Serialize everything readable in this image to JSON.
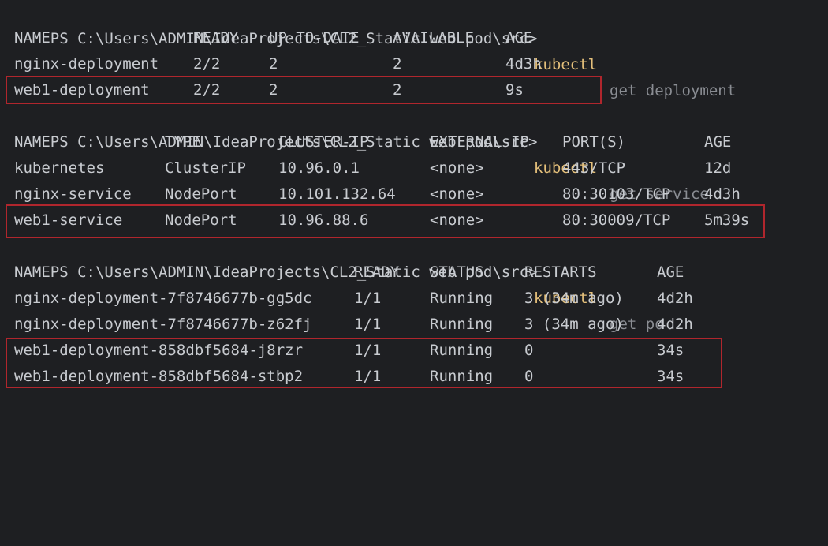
{
  "terminal": {
    "prompt": "PS C:\\Users\\ADMIN\\IdeaProjects\\CL2_Static web pod\\src>",
    "colors": {
      "background": "#1e1f22",
      "text": "#c8cbd0",
      "command": "#e5c07b",
      "args": "#8a8d93",
      "highlight_border": "#b0262d"
    },
    "deployment": {
      "command": "kubectl",
      "args": "get deployment",
      "headers": [
        "NAME",
        "READY",
        "UP-TO-DATE",
        "AVAILABLE",
        "AGE"
      ],
      "rows": [
        [
          "nginx-deployment",
          "2/2",
          "2",
          "2",
          "4d3h"
        ],
        [
          "web1-deployment",
          "2/2",
          "2",
          "2",
          "9s"
        ]
      ]
    },
    "service": {
      "command": "kubectl",
      "args": "get service",
      "headers": [
        "NAME",
        "TYPE",
        "CLUSTER-IP",
        "EXTERNAL-IP",
        "PORT(S)",
        "AGE"
      ],
      "rows": [
        [
          "kubernetes",
          "ClusterIP",
          "10.96.0.1",
          "<none>",
          "443/TCP",
          "12d"
        ],
        [
          "nginx-service",
          "NodePort",
          "10.101.132.64",
          "<none>",
          "80:30103/TCP",
          "4d3h"
        ],
        [
          "web1-service",
          "NodePort",
          "10.96.88.6",
          "<none>",
          "80:30009/TCP",
          "5m39s"
        ]
      ]
    },
    "pods": {
      "command": "kubectl",
      "args": "get po",
      "headers": [
        "NAME",
        "READY",
        "STATUS",
        "RESTARTS",
        "AGE"
      ],
      "rows": [
        [
          "nginx-deployment-7f8746677b-gg5dc",
          "1/1",
          "Running",
          "3 (34m ago)",
          "4d2h"
        ],
        [
          "nginx-deployment-7f8746677b-z62fj",
          "1/1",
          "Running",
          "3 (34m ago)",
          "4d2h"
        ],
        [
          "web1-deployment-858dbf5684-j8rzr",
          "1/1",
          "Running",
          "0",
          "34s"
        ],
        [
          "web1-deployment-858dbf5684-stbp2",
          "1/1",
          "Running",
          "0",
          "34s"
        ]
      ]
    }
  }
}
